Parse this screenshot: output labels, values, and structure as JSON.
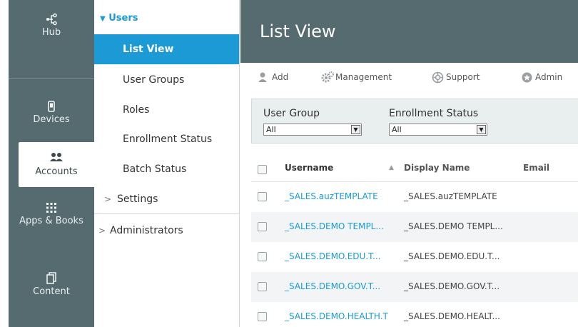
{
  "rail": {
    "items": [
      {
        "label": "Hub",
        "icon": "hub-icon",
        "glyph": "⊰"
      },
      {
        "label": "Devices",
        "icon": "phone-icon",
        "glyph": "▯"
      },
      {
        "label": "Accounts",
        "icon": "users-icon",
        "glyph": "●●"
      },
      {
        "label": "Apps & Books",
        "icon": "apps-grid-icon",
        "glyph": "⁞⁞⁞"
      },
      {
        "label": "Content",
        "icon": "documents-icon",
        "glyph": "⎘"
      }
    ]
  },
  "submenu": {
    "title": "Users",
    "items": [
      {
        "label": "List View",
        "active": true
      },
      {
        "label": "User Groups"
      },
      {
        "label": "Roles"
      },
      {
        "label": "Enrollment Status"
      },
      {
        "label": "Batch Status"
      },
      {
        "label": "Settings"
      },
      {
        "label": "Administrators"
      }
    ]
  },
  "header": {
    "title": "List View"
  },
  "toolbar": {
    "add": "Add",
    "management": "Management",
    "support": "Support",
    "admin": "Admin"
  },
  "filters": {
    "user_group_label": "User Group",
    "user_group_value": "All",
    "enrollment_label": "Enrollment Status",
    "enrollment_value": "All"
  },
  "table": {
    "columns": {
      "username": "Username",
      "display_name": "Display Name",
      "email": "Email"
    },
    "rows": [
      {
        "username": "_SALES.auzTEMPLATE",
        "display": "_SALES.auzTEMPLATE"
      },
      {
        "username": "_SALES.DEMO TEMPL...",
        "display": "_SALES.DEMO TEMPL..."
      },
      {
        "username": "_SALES.DEMO.EDU.T...",
        "display": "_SALES.DEMO.EDU.T..."
      },
      {
        "username": "_SALES.DEMO.GOV.T...",
        "display": "_SALES.DEMO.GOV.T..."
      },
      {
        "username": "_SALES.DEMO.HEALTH.T",
        "display": "_SALES.DEMO.HEALT..."
      }
    ]
  },
  "colors": {
    "rail": "#566b70",
    "accent": "#1c9ad6",
    "link": "#1a9bd7"
  }
}
